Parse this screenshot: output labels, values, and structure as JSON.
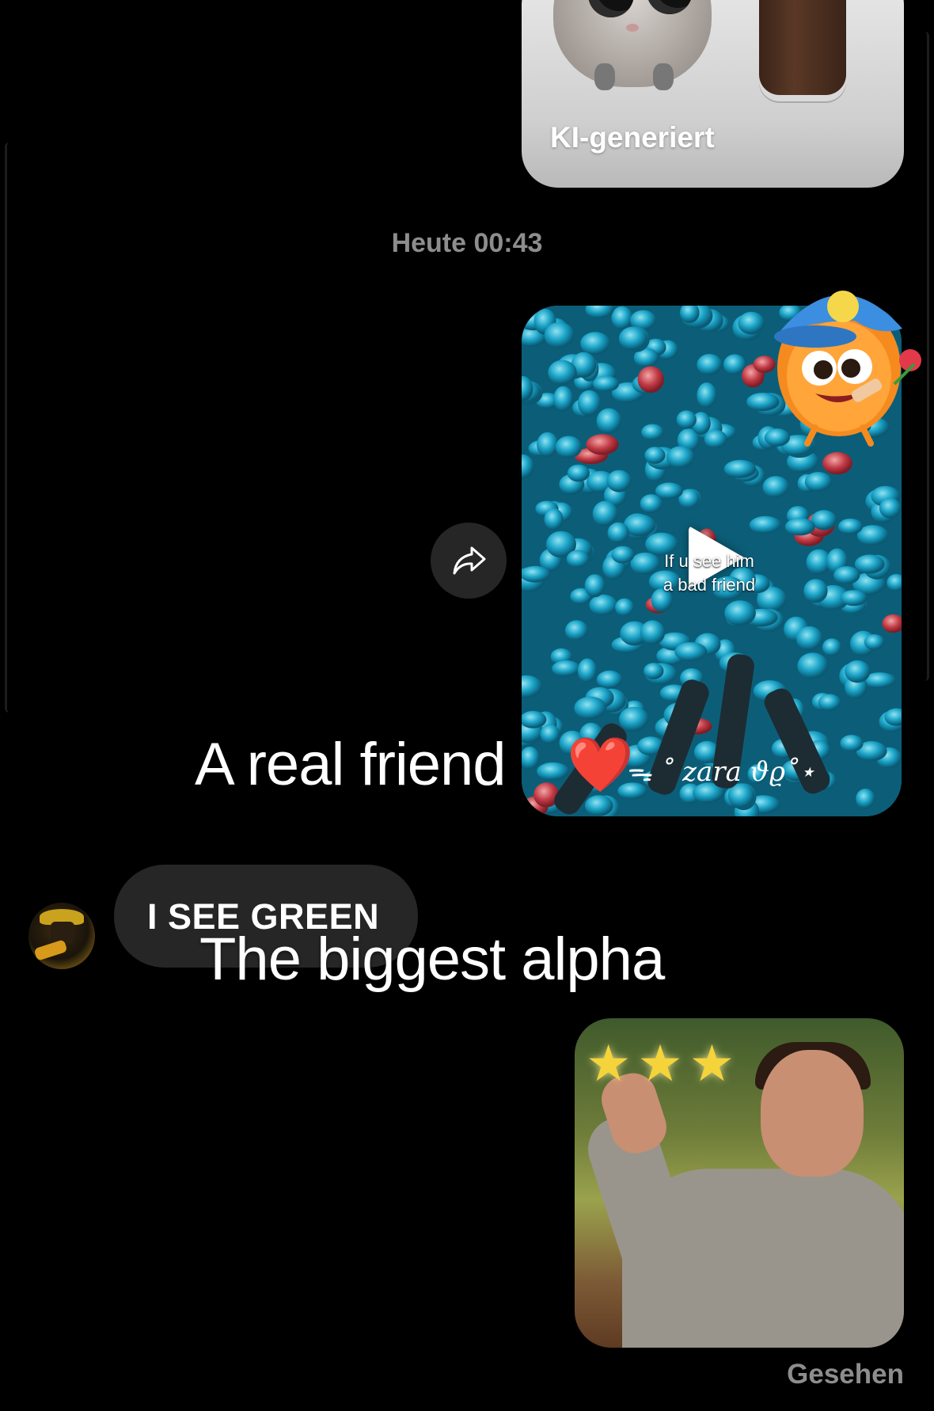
{
  "ai_card": {
    "label": "KI-generiert"
  },
  "timestamp": "Heute 00:43",
  "video": {
    "caption_line1": "If u see him",
    "caption_line2": "a bad friend"
  },
  "overlay": {
    "friend_text": "A real friend",
    "heart": "❤️",
    "name_tag": "ᯓ ˚ zara 𝜗𝜚˚⋆",
    "alpha_text": "The biggest alpha"
  },
  "received": {
    "message": "I SEE GREEN"
  },
  "photo": {
    "stars": "★★★"
  },
  "status": {
    "seen": "Gesehen"
  },
  "colors": {
    "background": "#000000",
    "bubble": "#262626",
    "muted_text": "#8d8d8d"
  },
  "icons": [
    "share-arrow-icon",
    "play-icon"
  ]
}
